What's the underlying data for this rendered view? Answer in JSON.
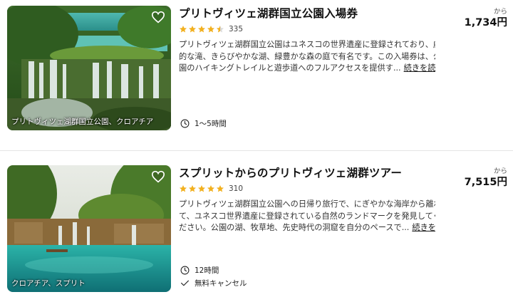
{
  "listings": [
    {
      "title": "プリトヴィツェ湖群国立公園入場券",
      "image_caption": "プリトヴィツェ湖群国立公園、クロアチア",
      "rating": 4.5,
      "rating_count": "335",
      "description_lines": [
        "プリトヴィツェ湖群国立公園はユネスコの世界遺産に登録されており、劇",
        "的な滝、きらびやかな湖、緑豊かな森の庭で有名です。この入場券は、公",
        "園のハイキングトレイルと遊歩道へのフルアクセスを提供す..."
      ],
      "read_more": "続きを読む",
      "duration": "1〜5時間",
      "price_prefix": "から",
      "price": "1,734円"
    },
    {
      "title": "スプリットからのプリトヴィツェ湖群ツアー",
      "image_caption": "クロアチア、スプリト",
      "rating": 5,
      "rating_count": "310",
      "description_lines": [
        "プリトヴィツェ湖群国立公園への日帰り旅行で、にぎやかな海岸から離れ",
        "て、ユネスコ世界遺産に登録されている自然のランドマークを発見してく",
        "ださい。公園の湖、牧草地、先史時代の洞窟を自分のペースで..."
      ],
      "read_more": "続きを読む",
      "duration": "12時間",
      "cancellation": "無料キャンセル",
      "price_prefix": "から",
      "price": "7,515円"
    }
  ],
  "colors": {
    "star": "#f2b01e",
    "text": "#1a1a1a",
    "divider": "#e4e4e4"
  },
  "icons": {
    "favorite": "heart-outline-icon",
    "duration": "clock-icon",
    "cancellation": "check-icon"
  }
}
